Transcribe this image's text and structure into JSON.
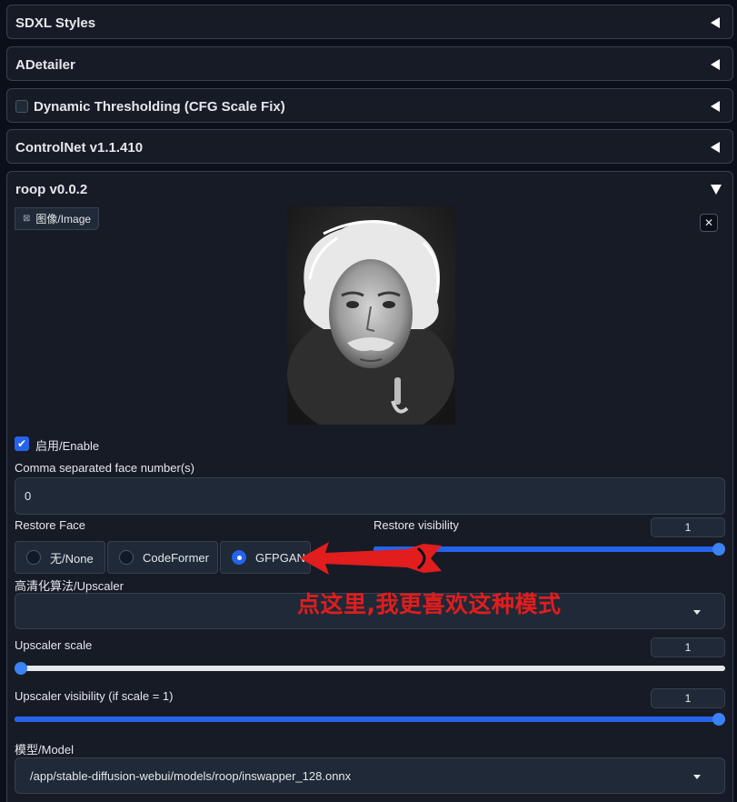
{
  "accordions": {
    "sdxl_styles": "SDXL Styles",
    "adetailer": "ADetailer",
    "dynamic_thresholding": "Dynamic Thresholding (CFG Scale Fix)",
    "controlnet": "ControlNet v1.1.410",
    "roop": "roop v0.0.2"
  },
  "roop": {
    "image_tag": "图像/Image",
    "close": "✕",
    "enable_label": "启用/Enable",
    "enable_checked": true,
    "face_numbers_label": "Comma separated face number(s)",
    "face_numbers_value": "0",
    "restore_face_label": "Restore Face",
    "restore_face_options": [
      "无/None",
      "CodeFormer",
      "GFPGAN"
    ],
    "restore_face_selected": "GFPGAN",
    "restore_visibility_label": "Restore visibility",
    "restore_visibility_value": "1",
    "upscaler_label": "高清化算法/Upscaler",
    "upscaler_value": "",
    "upscaler_scale_label": "Upscaler scale",
    "upscaler_scale_value": "1",
    "upscaler_visibility_label": "Upscaler visibility (if scale = 1)",
    "upscaler_visibility_value": "1",
    "model_label": "模型/Model",
    "model_value": "/app/stable-diffusion-webui/models/roop/inswapper_128.onnx"
  },
  "annotation": {
    "text": "点这里,我更喜欢这种模式",
    "color": "#e11d1d"
  },
  "colors": {
    "accent": "#2563eb",
    "background": "#0b0f19",
    "panel": "#161b26"
  }
}
